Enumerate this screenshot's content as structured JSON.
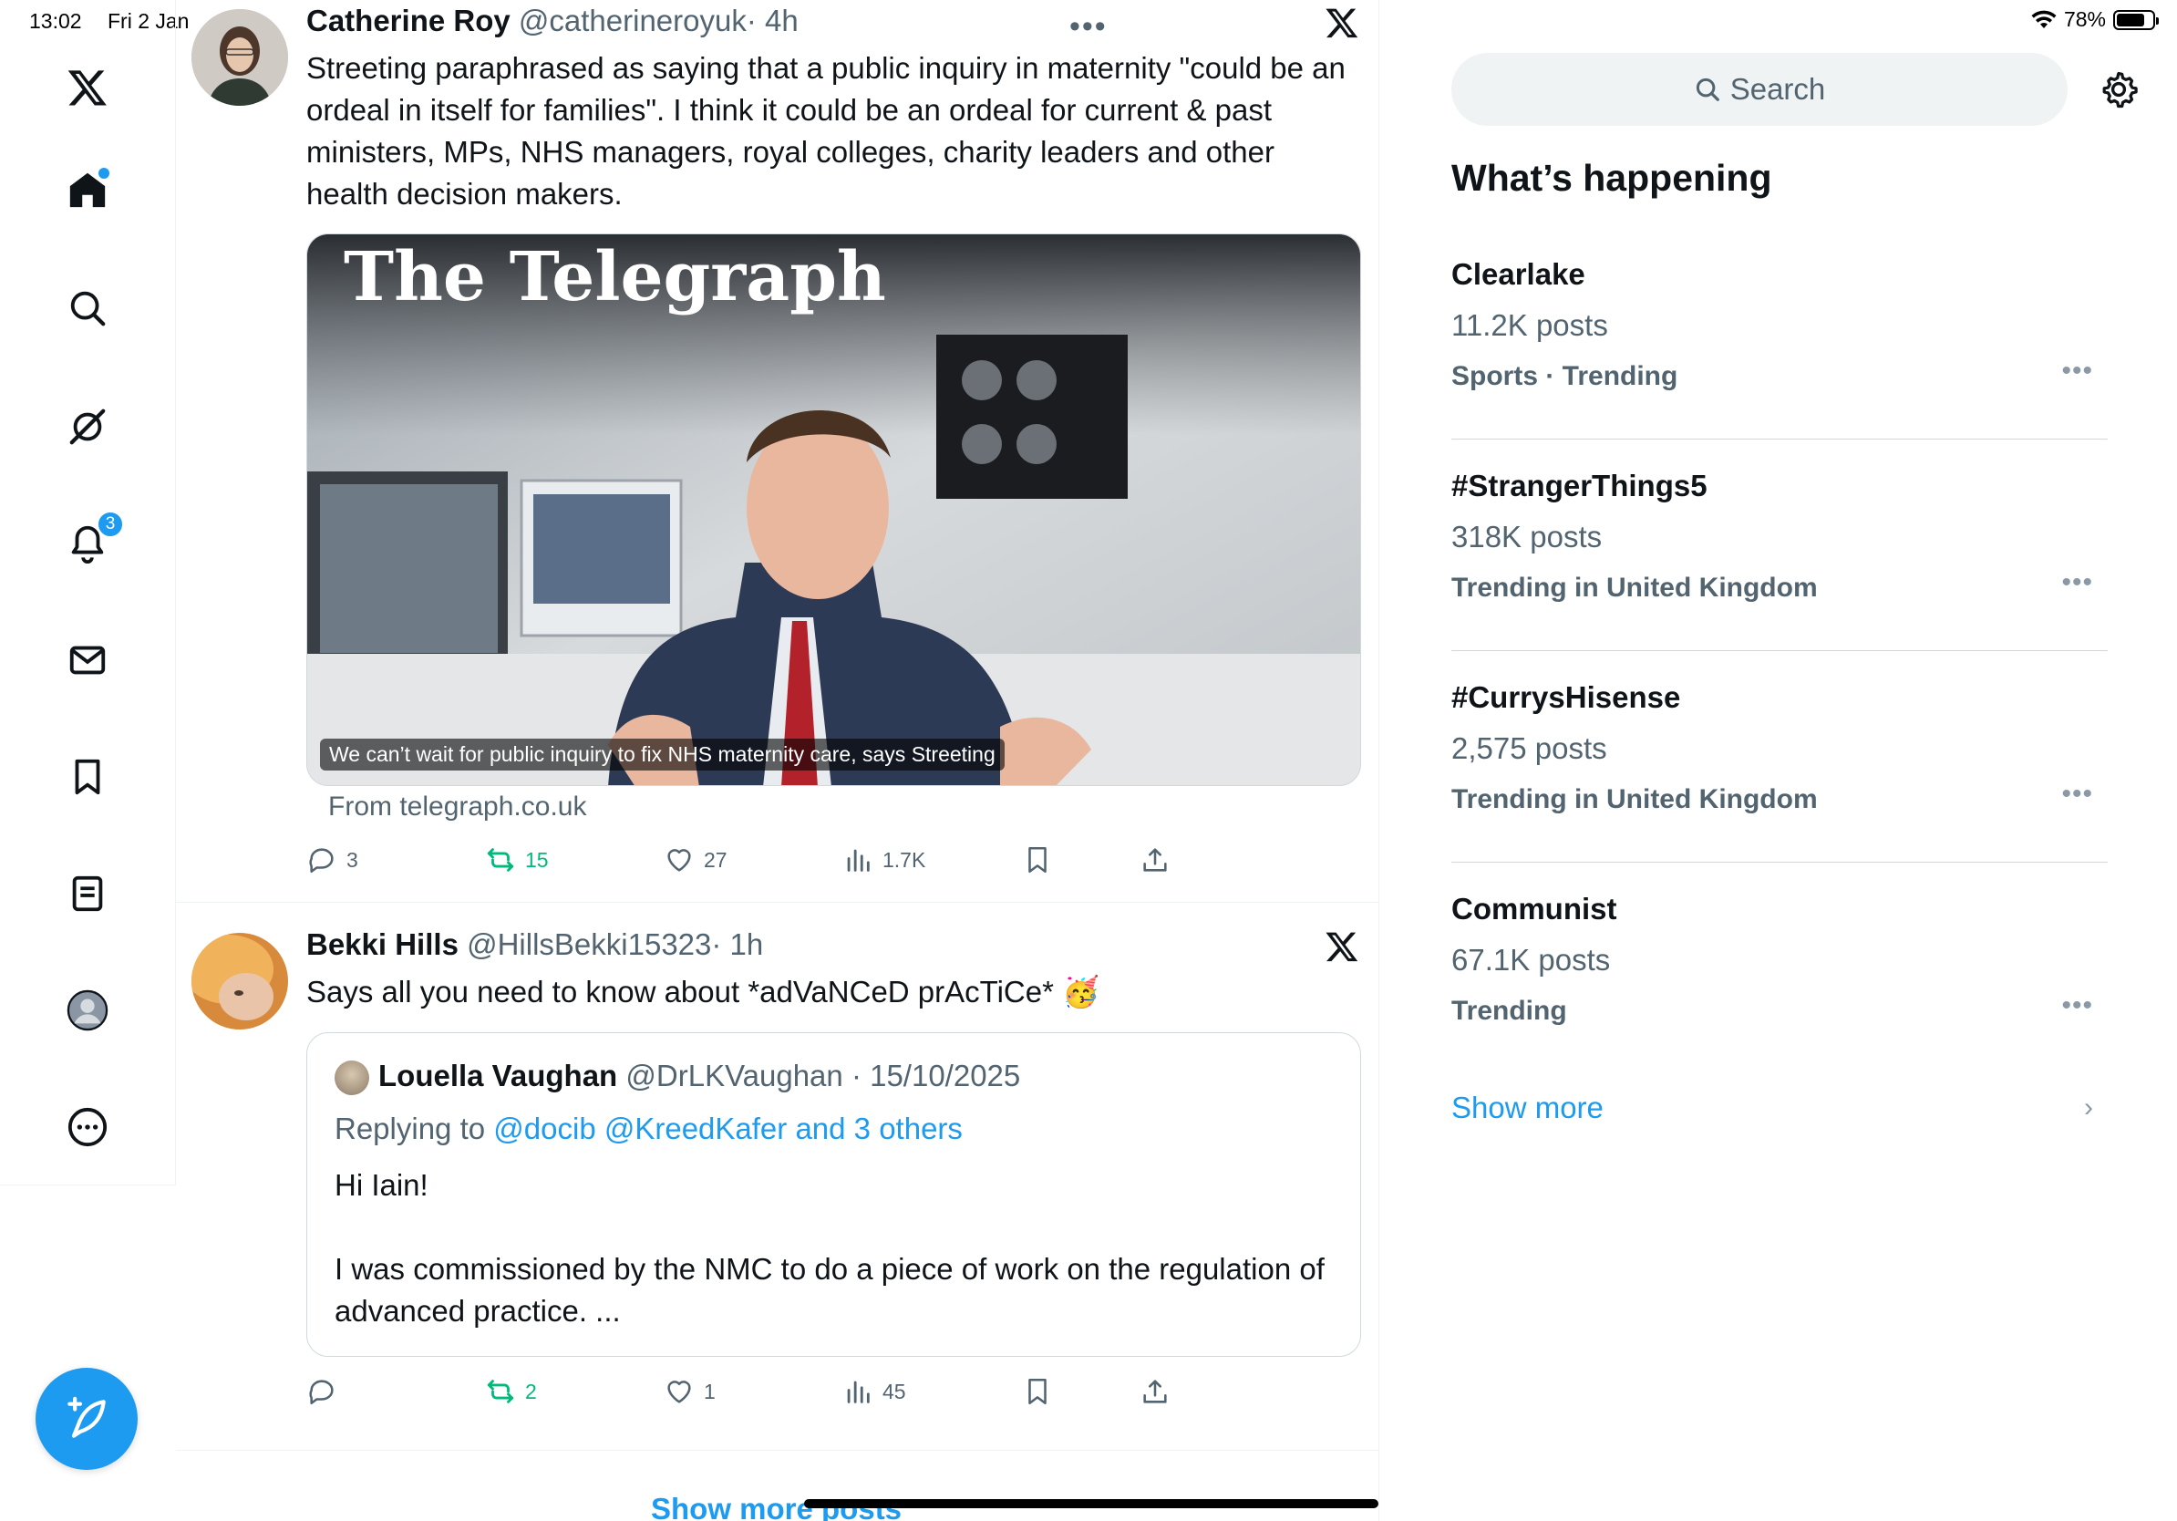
{
  "status_bar": {
    "time": "13:02",
    "date": "Fri 2 Jan",
    "battery": "78%",
    "battery_level": 0.78
  },
  "nav": {
    "notifications_badge": "3",
    "items": [
      "x-logo",
      "home",
      "explore",
      "grok",
      "notifications",
      "messages",
      "bookmarks",
      "lists",
      "profile",
      "more"
    ]
  },
  "tweets": [
    {
      "name": "Catherine Roy",
      "handle": "@catherineroyuk",
      "time": "· 4h",
      "text": "Streeting paraphrased as saying that a public inquiry in maternity \"could be an ordeal in itself for families\". I think it could be an ordeal for current & past ministers, MPs, NHS managers, royal colleges, charity leaders and other health decision makers.",
      "card": {
        "logo": "The Telegraph",
        "caption": "We can’t wait for public inquiry to fix NHS maternity care, says Streeting",
        "source": "From telegraph.co.uk"
      },
      "stats": {
        "replies": "3",
        "reposts": "15",
        "likes": "27",
        "views": "1.7K"
      }
    },
    {
      "name": "Bekki Hills",
      "handle": "@HillsBekki15323",
      "time": "· 1h",
      "text": "Says all you need to know about *adVaNCeD prAcTiCe* 🥳",
      "quote": {
        "name": "Louella Vaughan",
        "handle": "@DrLKVaughan",
        "time": "· 15/10/2025",
        "replying_prefix": "Replying to",
        "replying_to": "@docib @KreedKafer and 3 others",
        "line1": "Hi Iain!",
        "line2": "I was commissioned by the NMC to do a piece of work on the regulation of advanced practice. ..."
      },
      "stats": {
        "replies": "",
        "reposts": "2",
        "likes": "1",
        "views": "45"
      }
    }
  ],
  "show_more_posts": "Show more posts",
  "search": {
    "placeholder": "Search"
  },
  "whats_happening": {
    "title": "What’s happening",
    "trends": [
      {
        "name": "Clearlake",
        "count": "11.2K posts",
        "category": "Sports · Trending"
      },
      {
        "name": "#StrangerThings5",
        "count": "318K posts",
        "category": "Trending in United Kingdom"
      },
      {
        "name": "#CurrysHisense",
        "count": "2,575 posts",
        "category": "Trending in United Kingdom"
      },
      {
        "name": "Communist",
        "count": "67.1K posts",
        "category": "Trending"
      }
    ],
    "show_more": "Show more"
  },
  "colors": {
    "accent": "#1d9bf0",
    "repost_green": "#00ba7c",
    "muted": "#536471"
  }
}
